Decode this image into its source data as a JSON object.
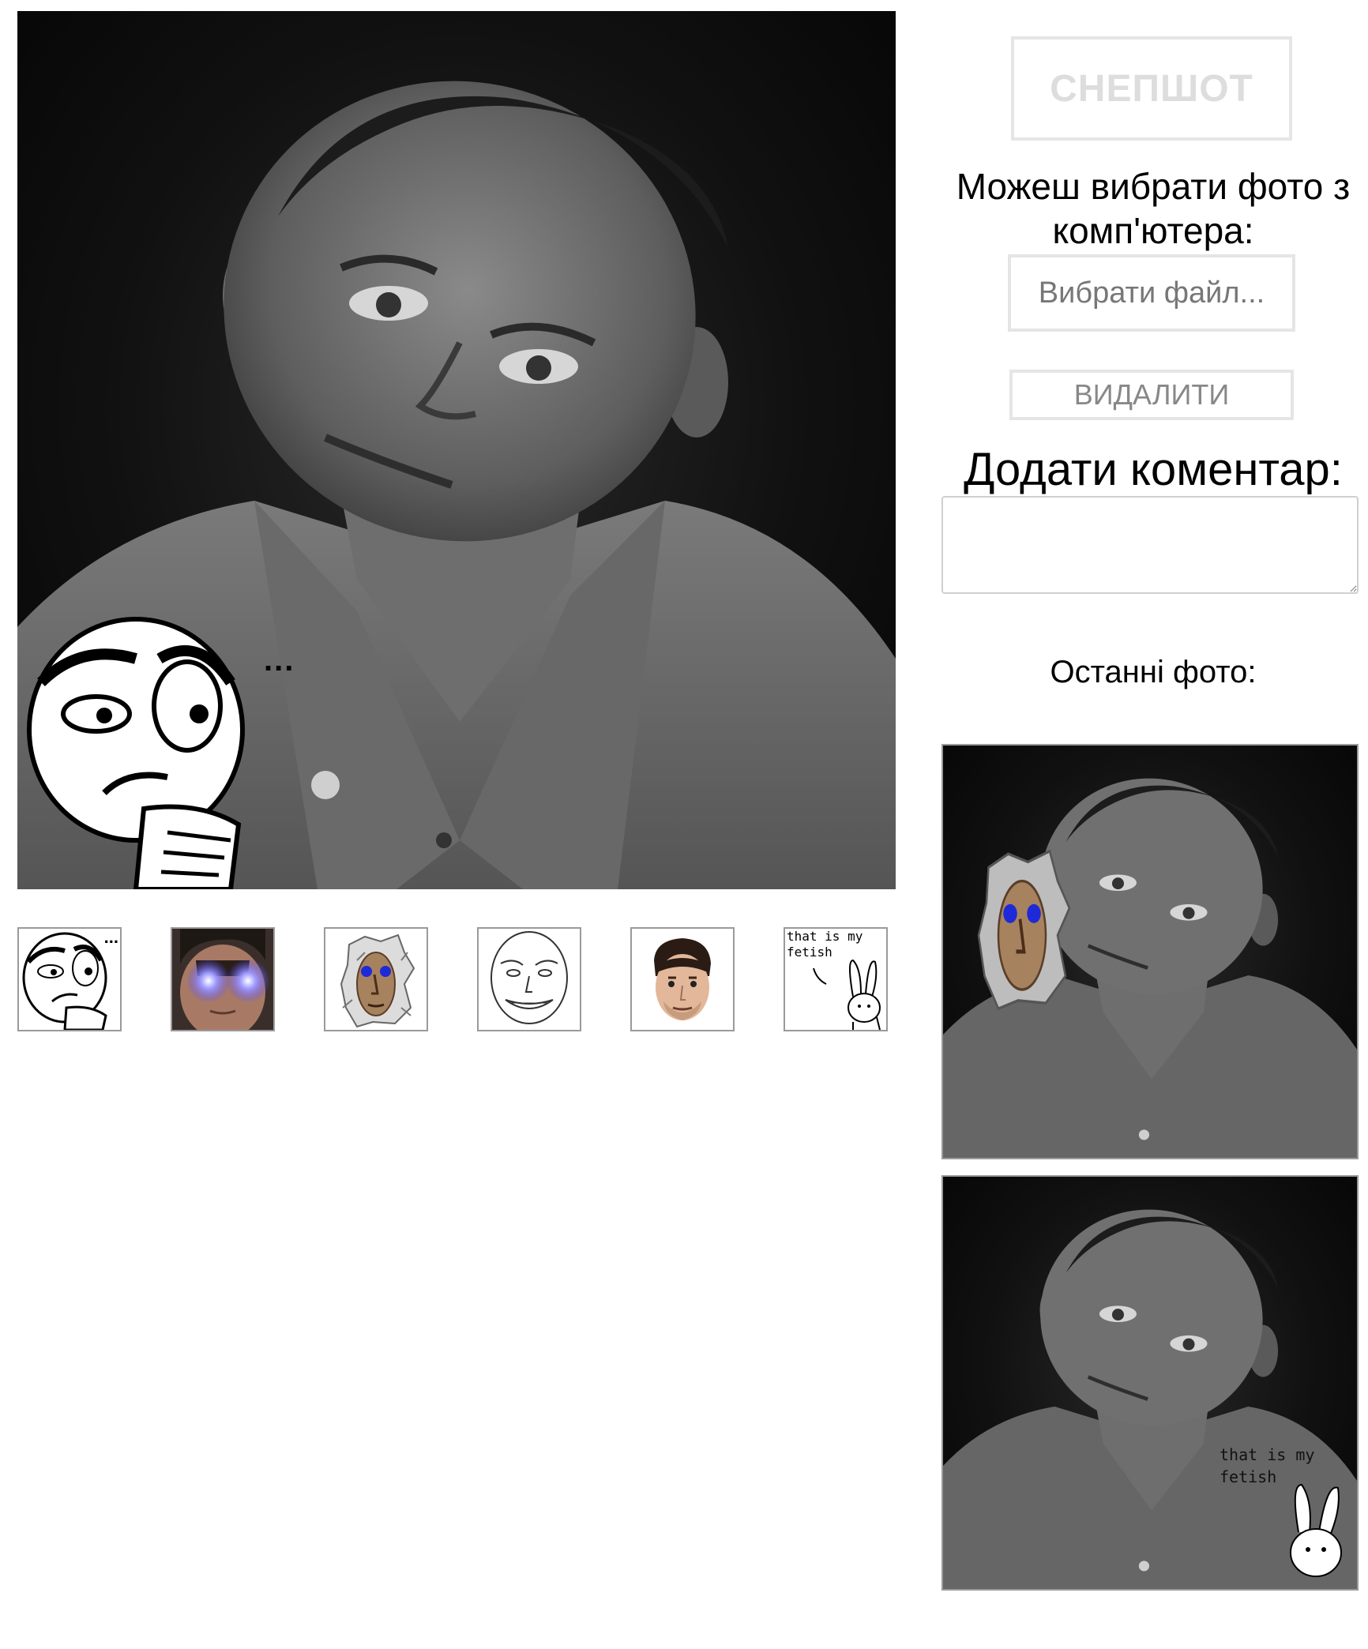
{
  "controls": {
    "snapshot_label": "СНЕПШОТ",
    "choose_label": "Можеш вибрати фото з комп'ютера:",
    "file_button_label": "Вибрати файл...",
    "delete_label": "ВИДАЛИТИ",
    "comment_label": "Додати коментар:",
    "comment_value": ""
  },
  "main_preview": {
    "sticker_caption": "..."
  },
  "stickers": [
    {
      "name": "thinking-rage-face",
      "caption": "..."
    },
    {
      "name": "glowing-eyes-guy"
    },
    {
      "name": "wall-face"
    },
    {
      "name": "smiling-face-sketch"
    },
    {
      "name": "kappa-face"
    },
    {
      "name": "bunny-fetish",
      "caption_line1": "that is my",
      "caption_line2": "fetish"
    }
  ],
  "recent": {
    "label": "Останні фото:",
    "photos": [
      {
        "sticker": "wall-face"
      },
      {
        "sticker": "bunny-fetish",
        "caption_line1": "that is my",
        "caption_line2": "fetish"
      }
    ]
  }
}
